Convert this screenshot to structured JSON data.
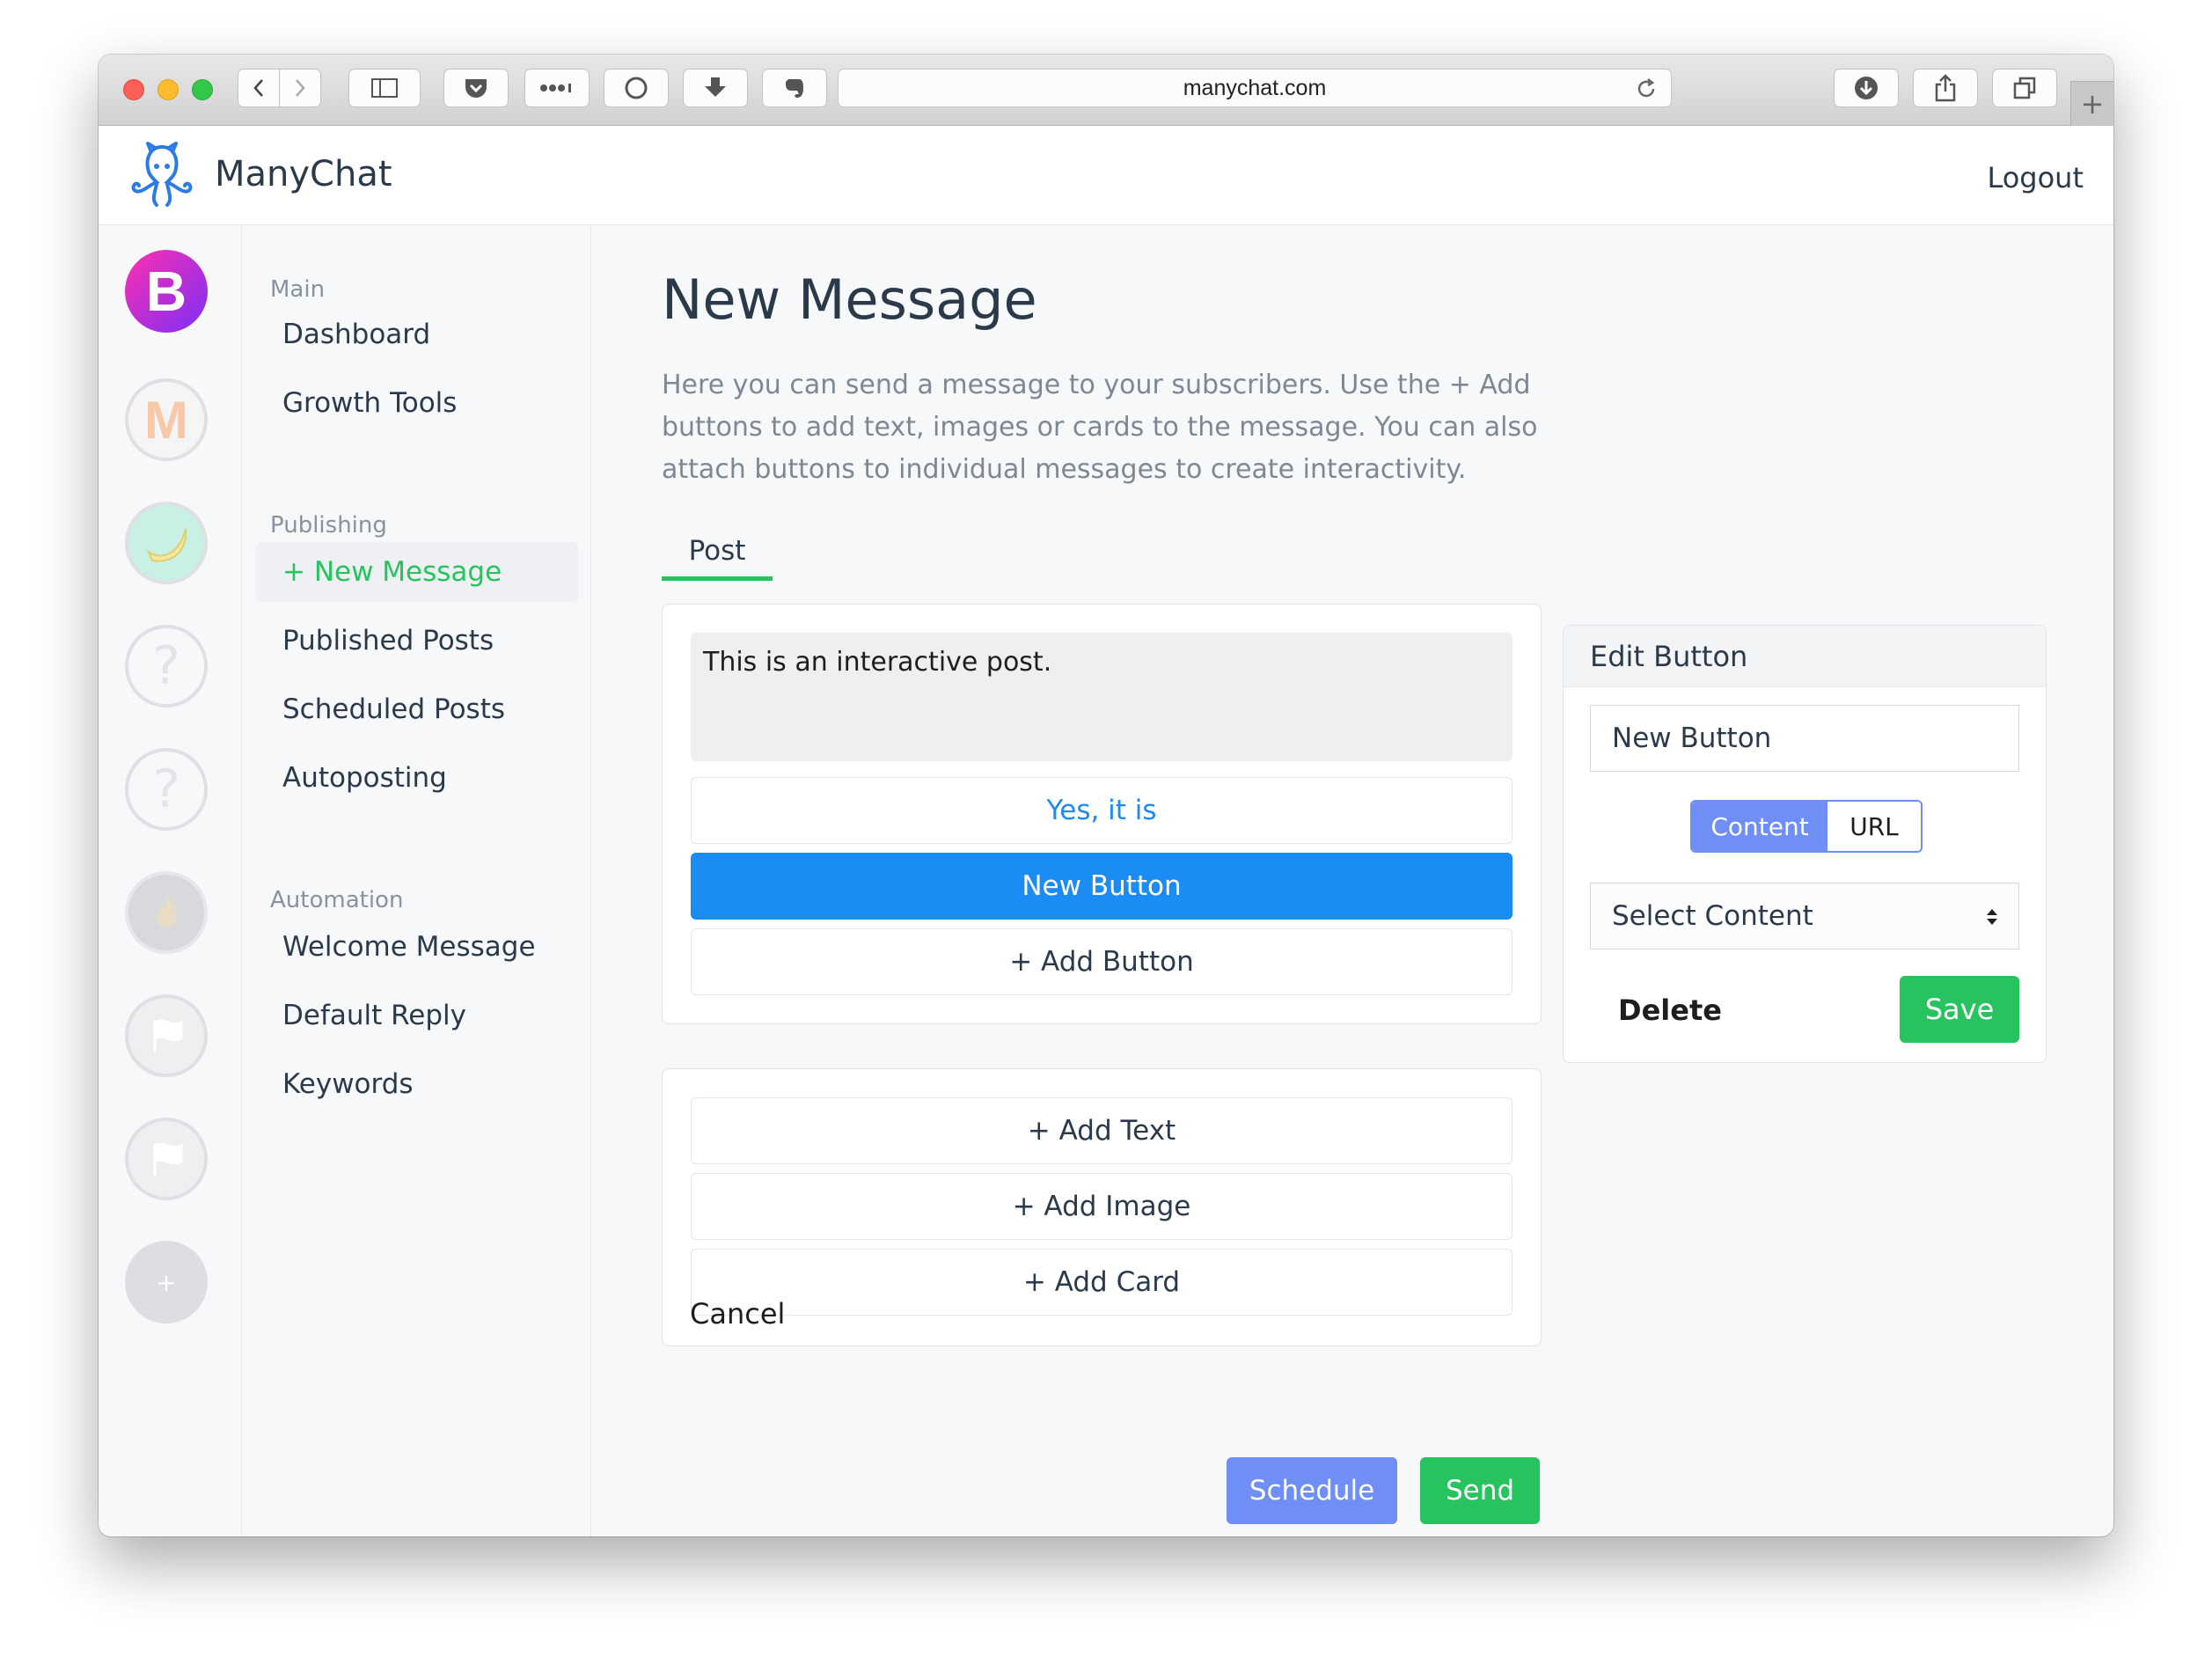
{
  "browser": {
    "url": "manychat.com"
  },
  "app": {
    "name": "ManyChat",
    "logout_label": "Logout"
  },
  "accounts": [
    {
      "initial": "B",
      "color": "#e13ad0"
    },
    {
      "initial": "M",
      "color": "#f7c9a8"
    },
    {
      "initial": "",
      "color": "#c8f0e4"
    },
    {
      "initial": "?",
      "color": "#e6e7ea"
    },
    {
      "initial": "?",
      "color": "#e6e7ea"
    },
    {
      "initial": "",
      "color": "#d3d5d9"
    },
    {
      "initial": "",
      "color": "#e6e7ea"
    },
    {
      "initial": "",
      "color": "#e6e7ea"
    },
    {
      "initial": "+",
      "color": "#dcdee2"
    }
  ],
  "sidebar": {
    "sections": [
      {
        "title": "Main",
        "items": [
          {
            "label": "Dashboard"
          },
          {
            "label": "Growth Tools"
          }
        ]
      },
      {
        "title": "Publishing",
        "items": [
          {
            "label": "+ New Message",
            "active": true
          },
          {
            "label": "Published Posts"
          },
          {
            "label": "Scheduled Posts"
          },
          {
            "label": "Autoposting"
          }
        ]
      },
      {
        "title": "Automation",
        "items": [
          {
            "label": "Welcome Message"
          },
          {
            "label": "Default Reply"
          },
          {
            "label": "Keywords"
          }
        ]
      }
    ]
  },
  "main": {
    "title": "New Message",
    "description": "Here you can send a message to your subscribers. Use the + Add buttons to add text, images or cards to the message. You can also attach buttons to individual messages to create interactivity.",
    "tab": "Post",
    "message": {
      "text": "This is an interactive post.",
      "buttons": [
        "Yes, it is",
        "New Button"
      ],
      "add_button_label": "+ Add Button"
    },
    "add_actions": [
      "+ Add Text",
      "+ Add Image",
      "+ Add Card"
    ],
    "cancel_label": "Cancel",
    "schedule_label": "Schedule",
    "send_label": "Send"
  },
  "edit_button": {
    "title": "Edit Button",
    "name_value": "New Button",
    "segment": {
      "options": [
        "Content",
        "URL"
      ],
      "selected": "Content"
    },
    "select_value": "Select Content",
    "delete_label": "Delete",
    "save_label": "Save"
  },
  "colors": {
    "green": "#27c35e",
    "blue": "#1c8cf5",
    "schedule": "#6f8ef6"
  }
}
